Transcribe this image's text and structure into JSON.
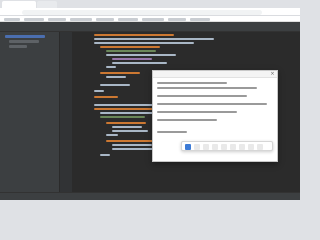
{
  "browser": {
    "tabs": [],
    "address": "",
    "bookmarks": []
  },
  "ide": {
    "title": "",
    "file_tree": [],
    "code_lines": [],
    "status": ""
  },
  "dialog": {
    "title": "",
    "body_lines": [],
    "toolbar": []
  },
  "colors": {
    "ide_background": "#2b2b2b",
    "ide_panel": "#3c3f41",
    "selection": "#4b6eaf",
    "active_tool": "#3d7bd6"
  }
}
